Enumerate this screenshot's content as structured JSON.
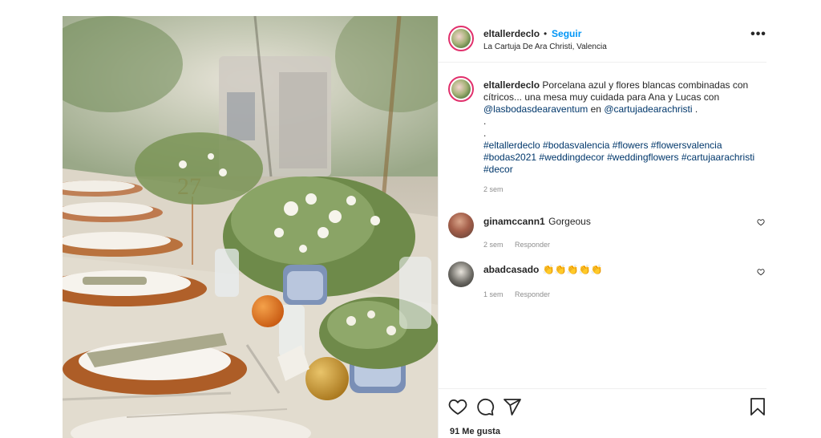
{
  "post": {
    "username": "eltallerdeclo",
    "dot": "•",
    "follow_label": "Seguir",
    "location": "La Cartuja De Ara Christi, Valencia",
    "more_label": "•••"
  },
  "caption": {
    "username": "eltallerdeclo",
    "text_1": "Porcelana azul y flores blancas combinadas con cítricos... una mesa muy cuidada para Ana y Lucas con",
    "mention_1": "@lasbodasdearaventum",
    "text_2": "en",
    "mention_2": "@cartujadearachristi",
    "text_3": ".",
    "dot_line_1": ".",
    "dot_line_2": ".",
    "hashtags": "#eltallerdeclo #bodasvalencia #flowers #flowersvalencia #bodas2021 #weddingdecor #weddingflowers #cartujaarachristi #decor",
    "time": "2 sem"
  },
  "comments": [
    {
      "username": "ginamccann1",
      "text": "Gorgeous",
      "time": "2 sem",
      "reply_label": "Responder"
    },
    {
      "username": "abadcasado",
      "text": "👏👏👏👏👏",
      "time": "1 sem",
      "reply_label": "Responder"
    }
  ],
  "actions": {
    "icons": [
      "heart-icon",
      "comment-icon",
      "share-icon",
      "bookmark-icon"
    ],
    "likes": "91 Me gusta"
  },
  "colors": {
    "follow": "#0095f6",
    "link": "#00376b",
    "muted": "#8e8e8e",
    "ring": "#e1306c"
  }
}
